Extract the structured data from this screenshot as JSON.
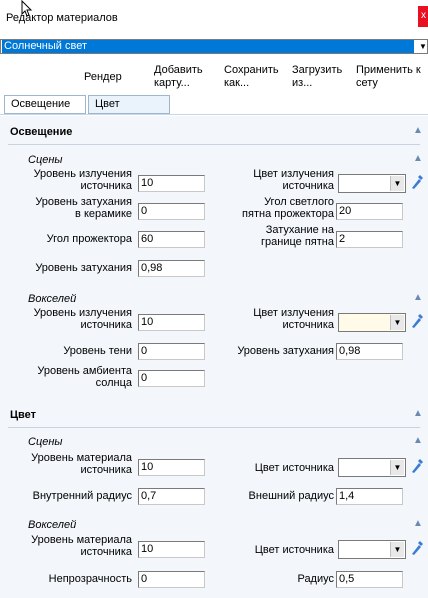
{
  "window": {
    "title": "Редактор материалов",
    "close_label": "x"
  },
  "preset": {
    "value": "Солнечный свет"
  },
  "toolbar": {
    "render": "Рендер",
    "add_map": "Добавить\nкарту...",
    "save_as": "Сохранить\nкак...",
    "load_from": "Загрузить\nиз...",
    "apply": "Применить к\nсету"
  },
  "tabs": [
    {
      "label": "Освещение"
    },
    {
      "label": "Цвет"
    }
  ],
  "lighting": {
    "title": "Освещение",
    "scenes": {
      "title": "Сцены",
      "emission_level_label": "Уровень излучения\nисточника",
      "emission_level_value": "10",
      "emission_color_label": "Цвет излучения\nисточника",
      "ceramic_attenuation_label": "Уровень затухания\nв керамике",
      "ceramic_attenuation_value": "0",
      "spot_angle_label": "Угол светлого\nпятна прожектора",
      "spot_angle_value": "20",
      "projector_angle_label": "Угол прожектора",
      "projector_angle_value": "60",
      "edge_falloff_label": "Затухание на\nгранице пятна",
      "edge_falloff_value": "2",
      "attenuation_label": "Уровень затухания",
      "attenuation_value": "0,98"
    },
    "voxels": {
      "title": "Вокселей",
      "emission_level_label": "Уровень излучения\nисточника",
      "emission_level_value": "10",
      "emission_color_label": "Цвет излучения\nисточника",
      "shadow_level_label": "Уровень тени",
      "shadow_level_value": "0",
      "attenuation_label": "Уровень затухания",
      "attenuation_value": "0,98",
      "sun_ambient_label": "Уровень амбиента\nсолнца",
      "sun_ambient_value": "0"
    }
  },
  "color": {
    "title": "Цвет",
    "scenes": {
      "title": "Сцены",
      "material_level_label": "Уровень материала\nисточника",
      "material_level_value": "10",
      "source_color_label": "Цвет источника",
      "inner_radius_label": "Внутренний радиус",
      "inner_radius_value": "0,7",
      "outer_radius_label": "Внешний радиус",
      "outer_radius_value": "1,4"
    },
    "voxels": {
      "title": "Вокселей",
      "material_level_label": "Уровень материала\nисточника",
      "material_level_value": "10",
      "source_color_label": "Цвет источника",
      "opacity_label": "Непрозрачность",
      "opacity_value": "0",
      "radius_label": "Радиус",
      "radius_value": "0,5"
    }
  },
  "colors": {
    "accent": "#0078d7",
    "close": "#e81123",
    "panel_bg": "#f3f6fa",
    "collapse_icon": "#6a8bb0",
    "eyedropper": "#3a7bd5"
  }
}
